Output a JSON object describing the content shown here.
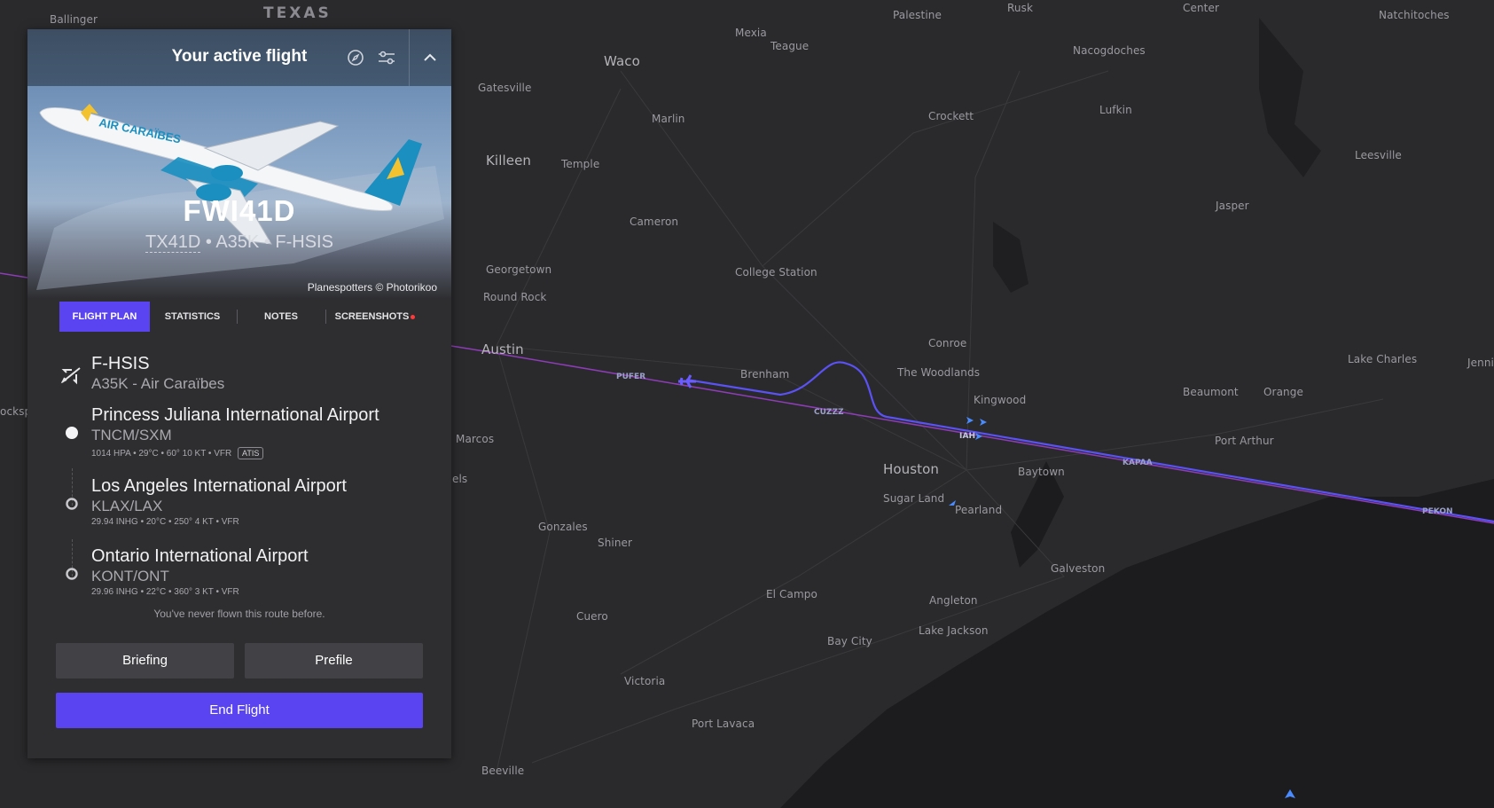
{
  "map": {
    "state_label": "TEXAS",
    "cities": [
      "Ballinger",
      "Palestine",
      "Rusk",
      "Center",
      "Natchitoches",
      "Mexia",
      "Teague",
      "Waco",
      "Nacogdoches",
      "Gatesville",
      "Marlin",
      "Crockett",
      "Lufkin",
      "Killeen",
      "Temple",
      "Leesville",
      "Jasper",
      "Cameron",
      "Georgetown",
      "College Station",
      "Round Rock",
      "Conroe",
      "Austin",
      "Brenham",
      "The Woodlands",
      "Lake Charles",
      "Jenni",
      "Kingwood",
      "Beaumont",
      "Orange",
      "IAH",
      "Marcos",
      "Port Arthur",
      "Houston",
      "Baytown",
      "els",
      "Sugar Land",
      "Pearland",
      "Gonzales",
      "Shiner",
      "Galveston",
      "El Campo",
      "Angleton",
      "Cuero",
      "Lake Jackson",
      "Bay City",
      "Victoria",
      "Port Lavaca",
      "Beeville",
      "ocksp"
    ],
    "waypoints": [
      "PUFER",
      "CUZZZ",
      "KAPAA",
      "PEKON"
    ],
    "colors": {
      "route": "#5b52f5",
      "route_secondary": "#8e3cb8",
      "aircraft": "#4a8cff",
      "own_aircraft": "#6a5cff"
    }
  },
  "panel": {
    "title": "Your active flight",
    "header_icons": [
      "compass-icon",
      "sliders-icon",
      "chevron-up-icon"
    ],
    "callsign": "FWI41D",
    "flight_number": "TX41D",
    "aircraft_type": "A35K",
    "registration": "F-HSIS",
    "photo_credit": "Planespotters © Photorikoo",
    "livery_text": "AIR CARAÏBES",
    "tabs": [
      {
        "label": "FLIGHT PLAN",
        "active": true
      },
      {
        "label": "STATISTICS",
        "active": false
      },
      {
        "label": "NOTES",
        "active": false
      },
      {
        "label": "SCREENSHOTS",
        "active": false,
        "badge": true
      }
    ],
    "aircraft": {
      "title": "F-HSIS",
      "sub": "A35K - Air Caraïbes"
    },
    "airports": [
      {
        "name": "Princess Juliana International Airport",
        "codes": "TNCM/SXM",
        "weather": "1014 HPA • 29°C • 60° 10 KT • VFR",
        "atis": "ATIS"
      },
      {
        "name": "Los Angeles International Airport",
        "codes": "KLAX/LAX",
        "weather": "29.94 INHG • 20°C • 250° 4 KT • VFR"
      },
      {
        "name": "Ontario International Airport",
        "codes": "KONT/ONT",
        "weather": "29.96 INHG • 22°C • 360° 3 KT • VFR"
      }
    ],
    "never_flown": "You've never flown this route before.",
    "buttons": {
      "briefing": "Briefing",
      "prefile": "Prefile",
      "end_flight": "End Flight"
    },
    "accent_color": "#5a44f2"
  }
}
